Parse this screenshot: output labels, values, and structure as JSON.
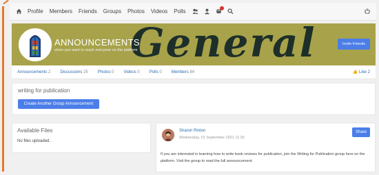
{
  "nav": {
    "items": [
      "Profile",
      "Members",
      "Friends",
      "Groups",
      "Photos",
      "Videos",
      "Polls"
    ]
  },
  "banner": {
    "title": "ANNOUNCEMENTS",
    "subtitle": "when you want to reach everyone on the platform",
    "bg_text": "General",
    "invite_label": "Invite Friends"
  },
  "tabs": [
    {
      "label": "Announcements",
      "count": "2"
    },
    {
      "label": "Discussions",
      "count": "25"
    },
    {
      "label": "Photos",
      "count": "0"
    },
    {
      "label": "Videos",
      "count": "0"
    },
    {
      "label": "Polls",
      "count": "0"
    },
    {
      "label": "Members",
      "count": "84"
    }
  ],
  "like": {
    "label": "Like",
    "count": "2"
  },
  "announce": {
    "title": "writing for publication",
    "button": "Create Another Group Announcement"
  },
  "files": {
    "title": "Available Files",
    "empty": "No files uploaded."
  },
  "post": {
    "author": "Sharon Rinton",
    "date": "Wednesday, 01 September 2021 11:30",
    "share_label": "Share",
    "body": "If you are interested in learning how to write book reviews for publication, join the Writing for Publication group here on the platform. Visit the group to read the full announcement."
  },
  "colors": {
    "accent": "#4b7ee8",
    "banner": "#a8a34a",
    "annotation": "#e8772a"
  }
}
